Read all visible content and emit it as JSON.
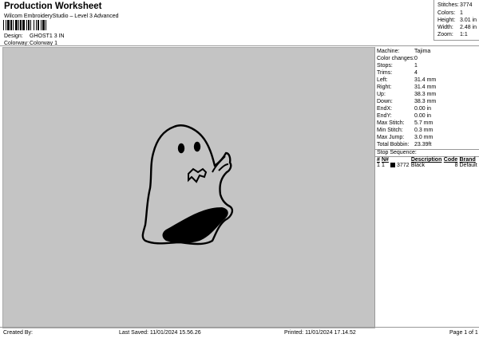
{
  "header": {
    "title": "Production Worksheet",
    "software": "Wilcom EmbroideryStudio – Level 3 Advanced"
  },
  "meta": [
    {
      "label": "Design:",
      "value": "GHOST1 3 IN"
    },
    {
      "label": "Colorway:",
      "value": "Colorway 1"
    }
  ],
  "summary": [
    {
      "label": "Stitches:",
      "value": "3774"
    },
    {
      "label": "Colors:",
      "value": "1"
    },
    {
      "label": "Height:",
      "value": "3.01 in"
    },
    {
      "label": "Width:",
      "value": "2.48 in"
    },
    {
      "label": "Zoom:",
      "value": "1:1"
    }
  ],
  "details": [
    {
      "label": "Machine:",
      "value": "Tajima"
    },
    {
      "label": "Color changes:",
      "value": "0"
    },
    {
      "label": "Stops:",
      "value": "1"
    },
    {
      "label": "Trims:",
      "value": "4"
    },
    {
      "label": "Left:",
      "value": "31.4 mm"
    },
    {
      "label": "Right:",
      "value": "31.4 mm"
    },
    {
      "label": "Up:",
      "value": "38.3 mm"
    },
    {
      "label": "Down:",
      "value": "38.3 mm"
    },
    {
      "label": "EndX:",
      "value": "0.00 in"
    },
    {
      "label": "EndY:",
      "value": "0.00 in"
    },
    {
      "label": "Max Stitch:",
      "value": "5.7 mm"
    },
    {
      "label": "Min Stitch:",
      "value": "0.3 mm"
    },
    {
      "label": "Max Jump:",
      "value": "3.0 mm"
    },
    {
      "label": "Total Bobbin:",
      "value": "23.39ft"
    }
  ],
  "stop_sequence": {
    "heading": "Stop Sequence:",
    "columns": [
      "#",
      "N#",
      "Description",
      "Code",
      "Brand"
    ],
    "rows": [
      {
        "num": "1",
        "n": "1",
        "stitches": "3772",
        "description": "Black",
        "code": "8",
        "brand": "Default",
        "color": "#000000"
      }
    ]
  },
  "footer": {
    "created_by": "Created By:",
    "last_saved": "Last Saved: 11/01/2024 15.56.26",
    "printed": "Printed: 11/01/2024 17.14.52",
    "page": "Page 1 of 1"
  },
  "colors": {
    "design_background": "#c4c4c4",
    "thread": "#000000"
  }
}
